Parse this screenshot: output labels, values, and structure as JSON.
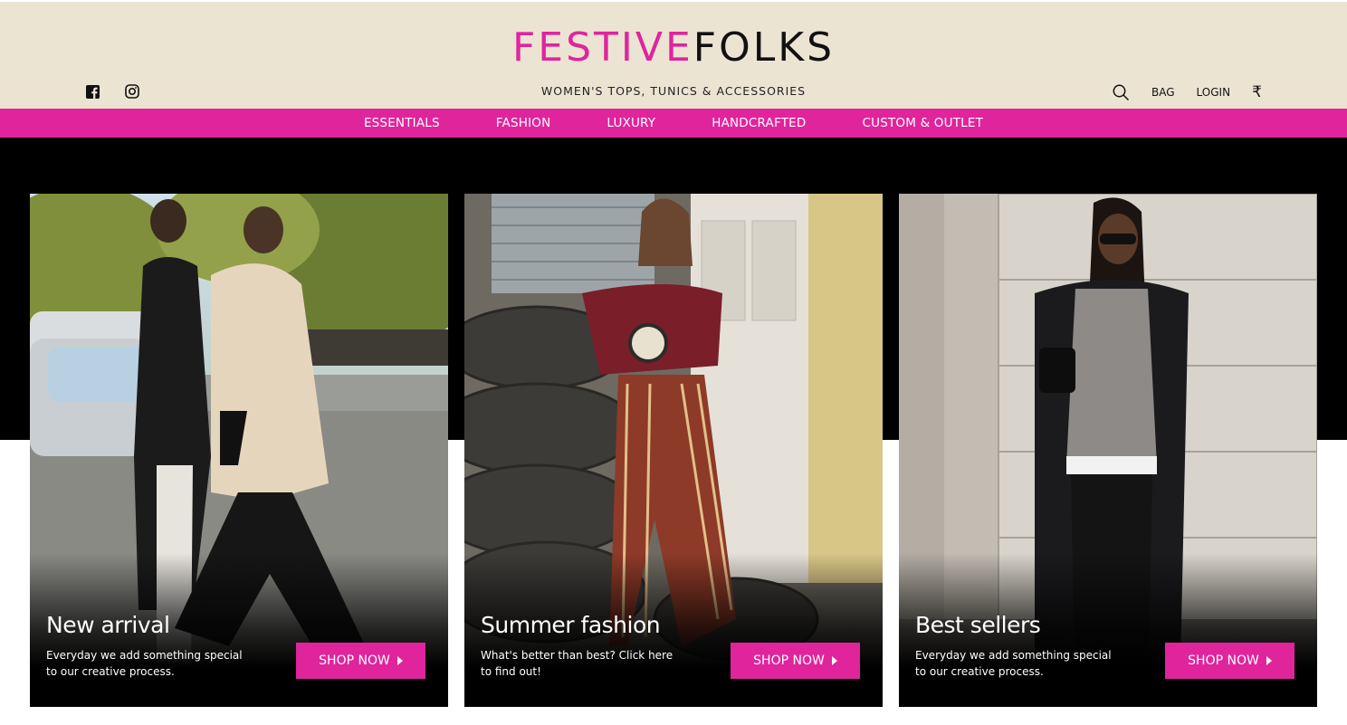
{
  "brand": {
    "part1": "FESTIVE",
    "part2": "FOLKS",
    "accent_color": "#e0249c"
  },
  "header": {
    "tagline": "WOMEN'S TOPS, TUNICS & ACCESSORIES",
    "social": [
      "facebook-icon",
      "instagram-icon"
    ],
    "bag_label": "BAG",
    "login_label": "LOGIN",
    "currency_symbol": "₹"
  },
  "nav": {
    "items": [
      {
        "label": "ESSENTIALS"
      },
      {
        "label": "FASHION"
      },
      {
        "label": "LUXURY"
      },
      {
        "label": "HANDCRAFTED"
      },
      {
        "label": "CUSTOM & OUTLET"
      }
    ]
  },
  "cards": [
    {
      "title": "New arrival",
      "desc": "Everyday we add something special to our creative process.",
      "button": "SHOP NOW"
    },
    {
      "title": "Summer fashion",
      "desc": "What's better than best? Click here to find out!",
      "button": "SHOP NOW"
    },
    {
      "title": "Best sellers",
      "desc": "Everyday we add something special to our creative process.",
      "button": "SHOP NOW"
    }
  ]
}
